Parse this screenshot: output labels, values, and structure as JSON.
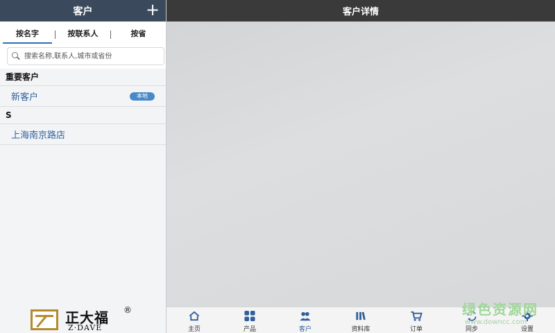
{
  "left": {
    "title": "客户",
    "add_label": "+",
    "tabs": [
      "按名字",
      "按联系人",
      "按省"
    ],
    "search_placeholder": "搜索名称,联系人,城市或省份",
    "sections": [
      {
        "header": "重要客户",
        "items": [
          {
            "name": "新客户",
            "badge": "本地"
          }
        ]
      },
      {
        "header": "S",
        "items": [
          {
            "name": "上海南京路店"
          }
        ]
      }
    ],
    "logo": {
      "cn": "正大福",
      "en": "Z·DAVE",
      "mark": "®"
    }
  },
  "right": {
    "title": "客户详情"
  },
  "nav": [
    {
      "label": "主页",
      "icon": "home-icon"
    },
    {
      "label": "产品",
      "icon": "grid-icon"
    },
    {
      "label": "客户",
      "icon": "users-icon"
    },
    {
      "label": "资料库",
      "icon": "library-icon"
    },
    {
      "label": "订单",
      "icon": "cart-icon"
    },
    {
      "label": "同步",
      "icon": "sync-icon"
    },
    {
      "label": "设置",
      "icon": "gear-icon"
    }
  ],
  "watermark": {
    "cn": "绿色资源网",
    "url": "www.downcc.com"
  },
  "colors": {
    "accent": "#2f5f9c",
    "header_left": "#3a4a5c",
    "header_right": "#3a3a3a",
    "badge": "#4a89c8"
  }
}
